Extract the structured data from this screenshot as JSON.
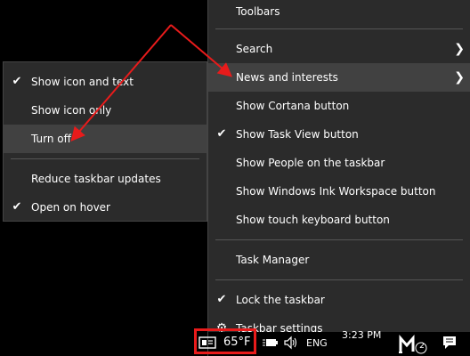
{
  "main_menu": {
    "items": [
      {
        "label": "Toolbars",
        "submenu": true
      },
      {
        "label": "Search",
        "submenu": true
      },
      {
        "label": "News and interests",
        "submenu": true
      },
      {
        "label": "Show Cortana button"
      },
      {
        "label": "Show Task View button",
        "checked": true
      },
      {
        "label": "Show People on the taskbar"
      },
      {
        "label": "Show Windows Ink Workspace button"
      },
      {
        "label": "Show touch keyboard button"
      },
      {
        "label": "Task Manager"
      },
      {
        "label": "Lock the taskbar",
        "checked": true
      },
      {
        "label": "Taskbar settings",
        "icon": "gear-icon"
      }
    ]
  },
  "sub_menu": {
    "items": [
      {
        "label": "Show icon and text",
        "checked": true
      },
      {
        "label": "Show icon only"
      },
      {
        "label": "Turn off"
      },
      {
        "label": "Reduce taskbar updates"
      },
      {
        "label": "Open on hover",
        "checked": true
      }
    ]
  },
  "taskbar": {
    "weather_temp": "65°F",
    "language": "ENG",
    "time": "3:23 PM",
    "notification_badge": "2"
  },
  "colors": {
    "menu_bg": "#2b2b2b",
    "highlight": "#414141",
    "annotation_red": "#e81b1b"
  }
}
